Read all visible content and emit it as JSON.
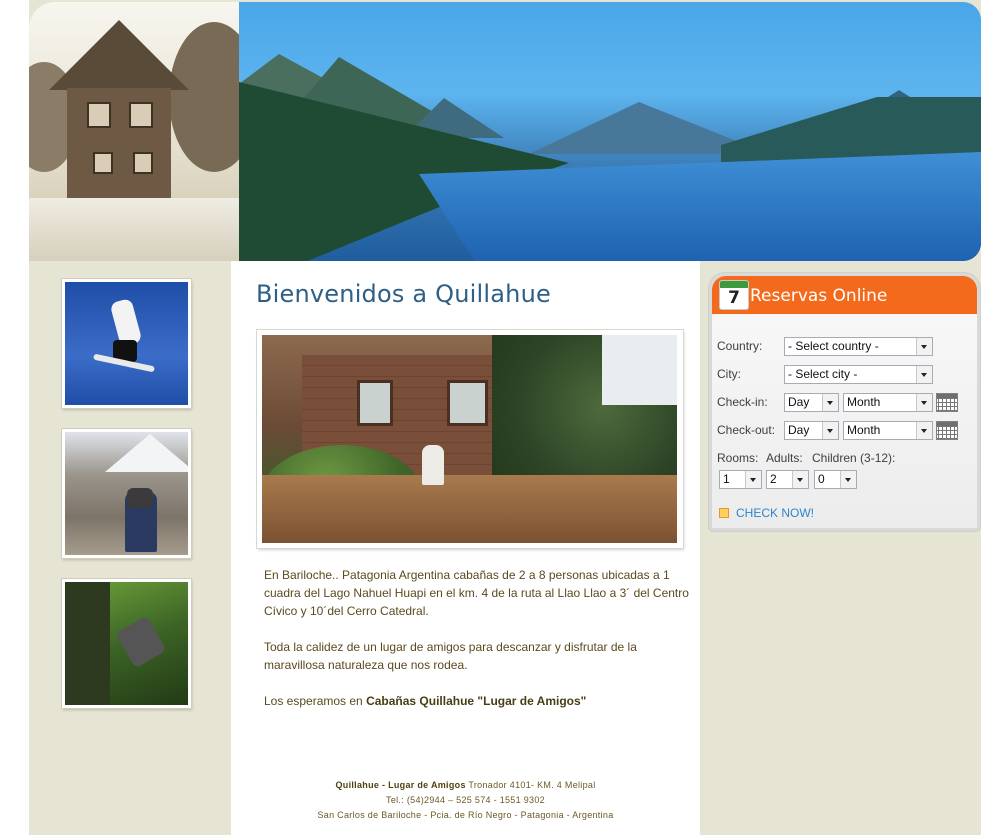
{
  "site": {
    "title": "Bienvenidos a Quillahue"
  },
  "content": {
    "paragraph1": "En Bariloche.. Patagonia Argentina cabañas de 2 a 8 personas ubicadas a 1 cuadra del Lago Nahuel Huapi en el km. 4 de la ruta al Llao Llao a 3´ del Centro Cívico y 10´del Cerro Catedral.",
    "paragraph2": "Toda la calidez de un lugar de amigos para descanzar y disfrutar de la maravillosa naturaleza que nos rodea.",
    "paragraph3_prefix": "Los esperamos en ",
    "paragraph3_bold": "Cabañas Quillahue \"Lugar de Amigos\""
  },
  "footer": {
    "name": "Quillahue - Lugar de Amigos",
    "address": " Tronador 4101- KM. 4 Melipal",
    "phone": "Tel.: (54)2944 – 525 574 - 1551 9302",
    "city": "San Carlos de Bariloche - Pcia. de Río Negro - Patagonia - Argentina"
  },
  "reservas": {
    "title": "Reservas Online",
    "calendar_day": "7",
    "country_label": "Country:",
    "country_value": "- Select country -",
    "city_label": "City:",
    "city_value": "- Select city -",
    "checkin_label": "Check-in:",
    "checkout_label": "Check-out:",
    "day_value": "Day",
    "month_value": "Month",
    "rooms_label": "Rooms:",
    "adults_label": "Adults:",
    "children_label": "Children (3-12):",
    "rooms_value": "1",
    "adults_value": "2",
    "children_value": "0",
    "check_now": "CHECK NOW!"
  }
}
